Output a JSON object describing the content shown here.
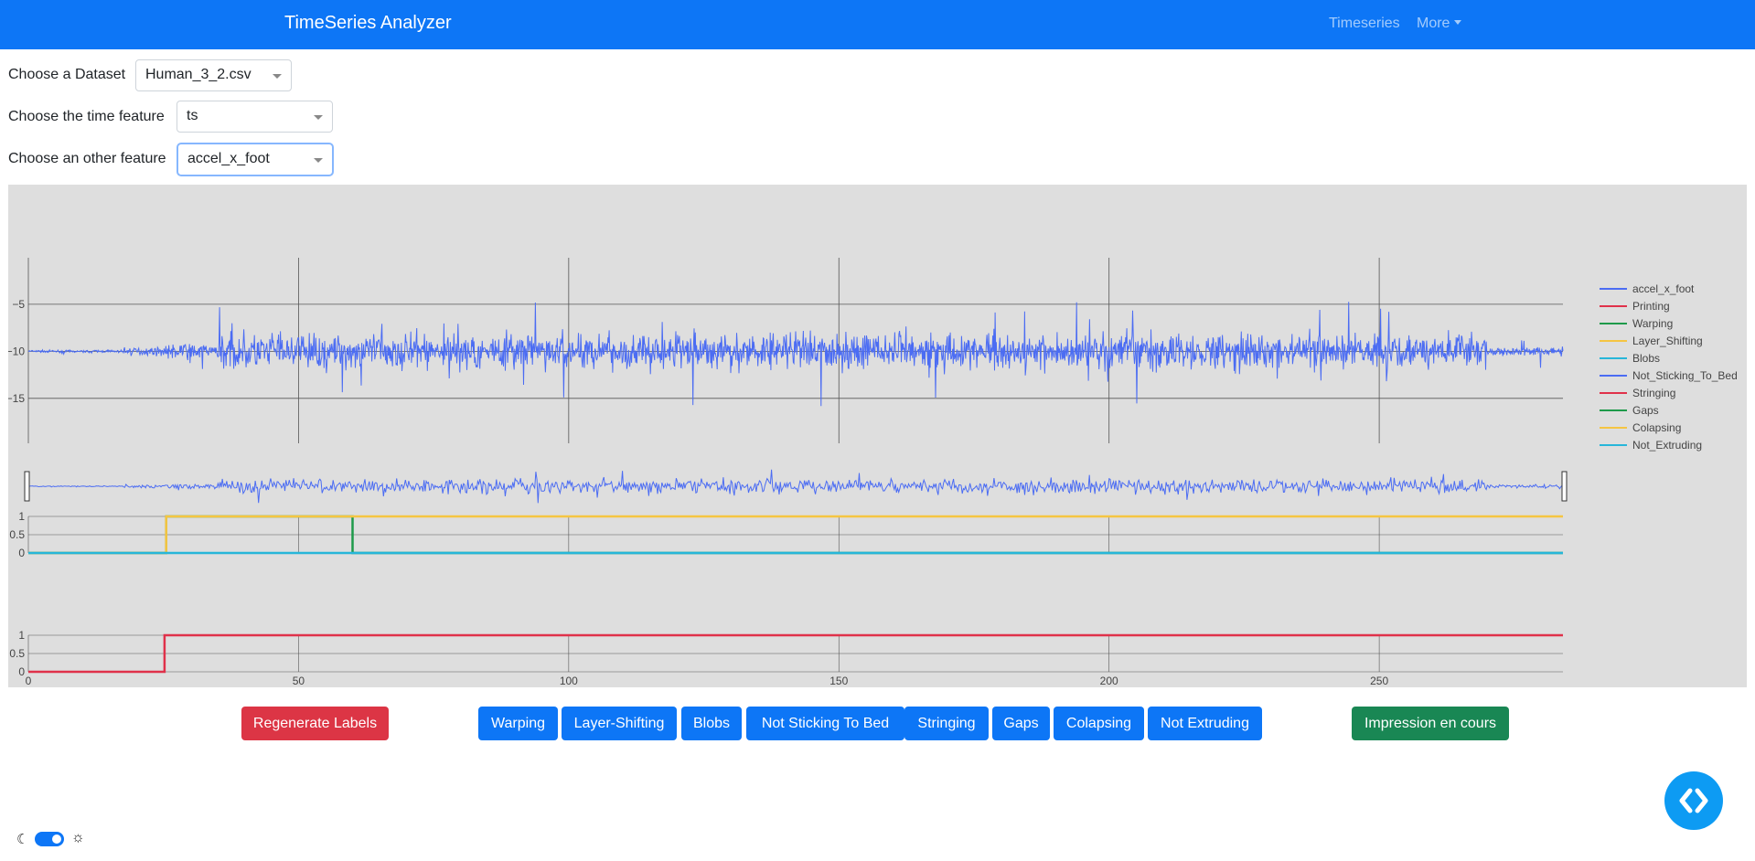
{
  "navbar": {
    "brand": "TimeSeries Analyzer",
    "links": [
      {
        "label": "Timeseries"
      },
      {
        "label": "More"
      }
    ]
  },
  "form": {
    "dataset": {
      "label": "Choose a Dataset",
      "value": "Human_3_2.csv"
    },
    "time_feature": {
      "label": "Choose the time feature",
      "value": "ts"
    },
    "other_feature": {
      "label": "Choose an other feature",
      "value": "accel_x_foot"
    }
  },
  "chart_data": {
    "type": "line",
    "x_ticks": [
      0,
      50,
      100,
      150,
      200,
      250
    ],
    "xlim": [
      0,
      284
    ],
    "main": {
      "series": "accel_x_foot",
      "y_ticks": [
        -5,
        -10,
        -15
      ],
      "ylim": [
        -19,
        -2
      ],
      "baseline": -10,
      "segments": [
        {
          "x_from": 0,
          "x_to": 17.5,
          "amplitude": 0.3
        },
        {
          "x_from": 17.5,
          "x_to": 25,
          "amplitude": 1.0
        },
        {
          "x_from": 25,
          "x_to": 35,
          "amplitude": 2.0
        },
        {
          "x_from": 35,
          "x_to": 270,
          "amplitude": 4.5
        },
        {
          "x_from": 270,
          "x_to": 284,
          "amplitude": 1.2
        }
      ]
    },
    "labels_panel": {
      "y_ticks": [
        1,
        0.5,
        0
      ],
      "ylim": [
        0,
        1
      ],
      "lines": [
        {
          "name": "Warping",
          "points": [
            [
              0,
              0
            ],
            [
              25.5,
              0
            ],
            [
              25.5,
              1
            ],
            [
              60,
              1
            ],
            [
              60,
              0
            ],
            [
              284,
              0
            ]
          ]
        },
        {
          "name": "Layer_Shifting",
          "points": [
            [
              0,
              0
            ],
            [
              25.5,
              0
            ],
            [
              25.5,
              1
            ],
            [
              284,
              1
            ]
          ]
        },
        {
          "name": "Not_Extruding",
          "points": [
            [
              0,
              0
            ],
            [
              284,
              0
            ]
          ]
        }
      ]
    },
    "printing_panel": {
      "y_ticks": [
        1,
        0.5,
        0
      ],
      "ylim": [
        0,
        1
      ],
      "lines": [
        {
          "name": "Printing",
          "points": [
            [
              0,
              0
            ],
            [
              25.2,
              0
            ],
            [
              25.2,
              1
            ],
            [
              284,
              1
            ]
          ]
        }
      ]
    },
    "legend": {
      "position": "right",
      "items": [
        {
          "name": "accel_x_foot",
          "color": "#4b6cf3"
        },
        {
          "name": "Printing",
          "color": "#e0314a"
        },
        {
          "name": "Warping",
          "color": "#1e9a4a"
        },
        {
          "name": "Layer_Shifting",
          "color": "#f5c542"
        },
        {
          "name": "Blobs",
          "color": "#27b6d9"
        },
        {
          "name": "Not_Sticking_To_Bed",
          "color": "#4b6cf3"
        },
        {
          "name": "Stringing",
          "color": "#e0314a"
        },
        {
          "name": "Gaps",
          "color": "#1e9a4a"
        },
        {
          "name": "Colapsing",
          "color": "#f5c542"
        },
        {
          "name": "Not_Extruding",
          "color": "#27b6d9"
        }
      ]
    }
  },
  "actions": {
    "regenerate": "Regenerate Labels",
    "labels": [
      "Warping",
      "Layer-Shifting",
      "Blobs",
      "Not Sticking To Bed",
      "Stringing",
      "Gaps",
      "Colapsing",
      "Not Extruding"
    ],
    "status": "Impression en cours"
  },
  "colors": {
    "primary": "#0d76f6",
    "danger": "#dc3545",
    "success": "#198754",
    "plot_bg": "#dedede"
  },
  "icons": {
    "fab": "code-brackets-icon",
    "theme_dark": "moon-icon",
    "theme_light": "sun-icon"
  }
}
